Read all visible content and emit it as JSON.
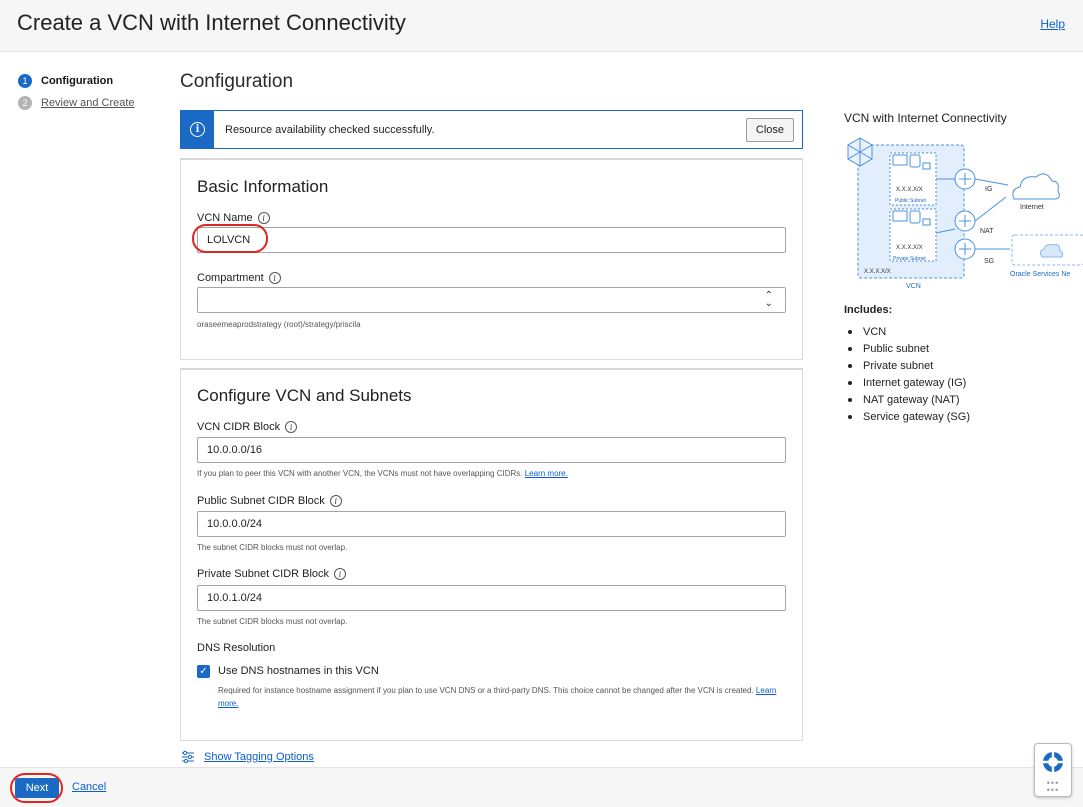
{
  "header": {
    "title": "Create a VCN with Internet Connectivity",
    "help": "Help"
  },
  "steps": [
    {
      "number": "1",
      "label": "Configuration"
    },
    {
      "number": "2",
      "label": "Review and Create"
    }
  ],
  "main": {
    "title": "Configuration",
    "info_bar": {
      "message": "Resource availability checked successfully.",
      "close_label": "Close"
    },
    "basic": {
      "heading": "Basic Information",
      "vcn_name_label": "VCN Name",
      "vcn_name_value": "LOLVCN",
      "compartment_label": "Compartment",
      "compartment_value": "",
      "compartment_path": "oraseemeaprodstrategy (root)/strategy/priscila"
    },
    "vcn": {
      "heading": "Configure VCN and Subnets",
      "cidr_label": "VCN CIDR Block",
      "cidr_value": "10.0.0.0/16",
      "cidr_hint": "If you plan to peer this VCN with another VCN, the VCNs must not have overlapping CIDRs.",
      "learn_more": "Learn more.",
      "public_label": "Public Subnet CIDR Block",
      "public_value": "10.0.0.0/24",
      "public_hint": "The subnet CIDR blocks must not overlap.",
      "private_label": "Private Subnet CIDR Block",
      "private_value": "10.0.1.0/24",
      "private_hint": "The subnet CIDR blocks must not overlap.",
      "dns_label": "DNS Resolution",
      "dns_checkbox_label": "Use DNS hostnames in this VCN",
      "dns_checked": true,
      "dns_hint": "Required for instance hostname assignment if you plan to use VCN DNS or a third-party DNS. This choice cannot be changed after the VCN is created.",
      "dns_learn_more": "Learn more."
    },
    "tagging_label": "Show Tagging Options"
  },
  "footer": {
    "next_label": "Next",
    "cancel_label": "Cancel"
  },
  "right_panel": {
    "title": "VCN with Internet Connectivity",
    "diagram": {
      "subnet_cidr": "X.X.X.X/X",
      "public_subnet": "Public Subnet",
      "private_subnet": "Private Subnet",
      "vcn_cidr": "X.X.X.X/X",
      "vcn": "VCN",
      "ig": "IG",
      "nat": "NAT",
      "sg": "SG",
      "internet": "Internet",
      "oracle_services": "Oracle Services Ne"
    },
    "includes_title": "Includes:",
    "includes": [
      "VCN",
      "Public subnet",
      "Private subnet",
      "Internet gateway (IG)",
      "NAT gateway (NAT)",
      "Service gateway (SG)"
    ]
  },
  "colors": {
    "accent": "#1a69c5",
    "highlight": "#e0241f",
    "link": "#0a5ed6"
  }
}
